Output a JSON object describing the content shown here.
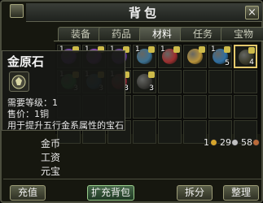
{
  "window": {
    "title": "背包",
    "close_glyph": "×"
  },
  "tabs": [
    {
      "label": "装备",
      "active": false
    },
    {
      "label": "药品",
      "active": false
    },
    {
      "label": "材料",
      "active": true
    },
    {
      "label": "任务",
      "active": false
    },
    {
      "label": "宝物",
      "active": false
    }
  ],
  "inventory": {
    "slots": [
      {
        "icon": "purple-gem-icon",
        "color": "#7a3bbf",
        "qty_top": "1",
        "qty_bot": ""
      },
      {
        "icon": "purple-gem-icon",
        "color": "#8c3cc0",
        "qty_top": "1",
        "qty_bot": ""
      },
      {
        "icon": "purple-gem-icon",
        "color": "#6d3aa8",
        "qty_top": "1",
        "qty_bot": ""
      },
      {
        "icon": "blue-gem-icon",
        "color": "#3b6f8f",
        "qty_top": "1",
        "qty_bot": ""
      },
      {
        "icon": "red-gem-icon",
        "color": "#9c2f2f",
        "qty_top": "1",
        "qty_bot": ""
      },
      {
        "icon": "gold-pouch-icon",
        "color": "#b8923a",
        "qty_top": "",
        "qty_bot": ""
      },
      {
        "icon": "blue-gem-icon",
        "color": "#2f6ea0",
        "qty_top": "1",
        "qty_bot": "5"
      },
      {
        "icon": "gold-gem-icon",
        "color": "#3a3a2a",
        "qty_top": "",
        "qty_bot": "4"
      },
      {
        "icon": "green-gem-icon",
        "color": "#2a9a4a",
        "qty_top": "1",
        "qty_bot": "3"
      },
      {
        "icon": "blue-gem-icon",
        "color": "#2b5f8c",
        "qty_top": "1",
        "qty_bot": "3"
      },
      {
        "icon": "red-gem-icon",
        "color": "#a32a3a",
        "qty_top": "1",
        "qty_bot": "3"
      },
      {
        "icon": "dark-ore-icon",
        "color": "#3a3a36",
        "qty_top": "",
        "qty_bot": "3"
      }
    ]
  },
  "tooltip": {
    "name": "金原石",
    "required_level": "需要等级：1",
    "price": "售价：1铜",
    "description": "用于提升五行金系属性的宝石"
  },
  "money": {
    "gold_label": "金币",
    "gold_amount": "1",
    "silver_amount": "29",
    "copper_amount": "58",
    "wage_label": "工资",
    "yuanbao_label": "元宝"
  },
  "buttons": {
    "recharge": "充值",
    "expand": "扩充背包",
    "split": "拆分",
    "sort": "整理"
  }
}
